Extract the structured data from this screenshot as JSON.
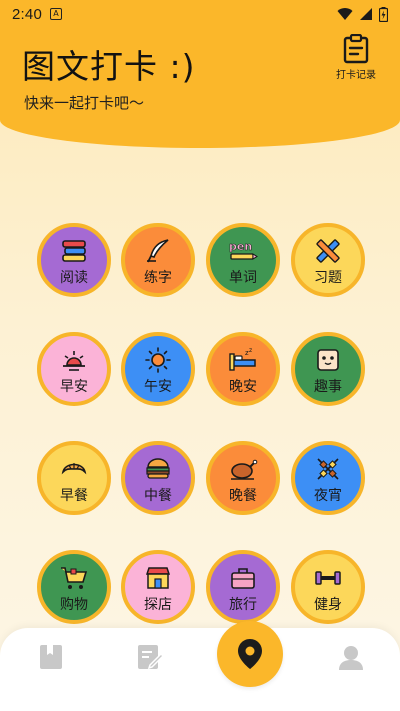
{
  "status_bar": {
    "time": "2:40",
    "notification_icon": "letter-a-icon"
  },
  "header": {
    "title": "图文打卡 :)",
    "subtitle": "快来一起打卡吧〜",
    "records_label": "打卡记录",
    "color": "#fbb72a"
  },
  "categories": [
    {
      "label": "阅读",
      "icon": "books-icon",
      "color": "#a56ad3"
    },
    {
      "label": "练字",
      "icon": "quill-pen-icon",
      "color": "#fb8c3a"
    },
    {
      "label": "单词",
      "icon": "pen-word-icon",
      "color": "#3f9652"
    },
    {
      "label": "习题",
      "icon": "pencil-ruler-icon",
      "color": "#fcd75a"
    },
    {
      "label": "早安",
      "icon": "sunrise-icon",
      "color": "#fbb3d7"
    },
    {
      "label": "午安",
      "icon": "sun-icon",
      "color": "#3d8ff5"
    },
    {
      "label": "晚安",
      "icon": "bed-icon",
      "color": "#fb8c3a"
    },
    {
      "label": "趣事",
      "icon": "smile-box-icon",
      "color": "#3f9652"
    },
    {
      "label": "早餐",
      "icon": "croissant-icon",
      "color": "#fcd75a"
    },
    {
      "label": "中餐",
      "icon": "burger-icon",
      "color": "#a56ad3"
    },
    {
      "label": "晚餐",
      "icon": "roast-chicken-icon",
      "color": "#fb8c3a"
    },
    {
      "label": "夜宵",
      "icon": "skewers-icon",
      "color": "#3d8ff5"
    },
    {
      "label": "购物",
      "icon": "shopping-cart-icon",
      "color": "#3f9652"
    },
    {
      "label": "探店",
      "icon": "shop-icon",
      "color": "#fbb3d7"
    },
    {
      "label": "旅行",
      "icon": "suitcase-icon",
      "color": "#a56ad3"
    },
    {
      "label": "健身",
      "icon": "dumbbell-icon",
      "color": "#fcd75a"
    }
  ],
  "bottom_nav": {
    "items": [
      {
        "icon": "bookmark-book-icon"
      },
      {
        "icon": "edit-note-icon"
      },
      {
        "icon": "location-pin-icon"
      },
      {
        "icon": "user-profile-icon"
      }
    ],
    "active_color": "#fbb72a",
    "inactive_color": "#c8c8c8"
  }
}
